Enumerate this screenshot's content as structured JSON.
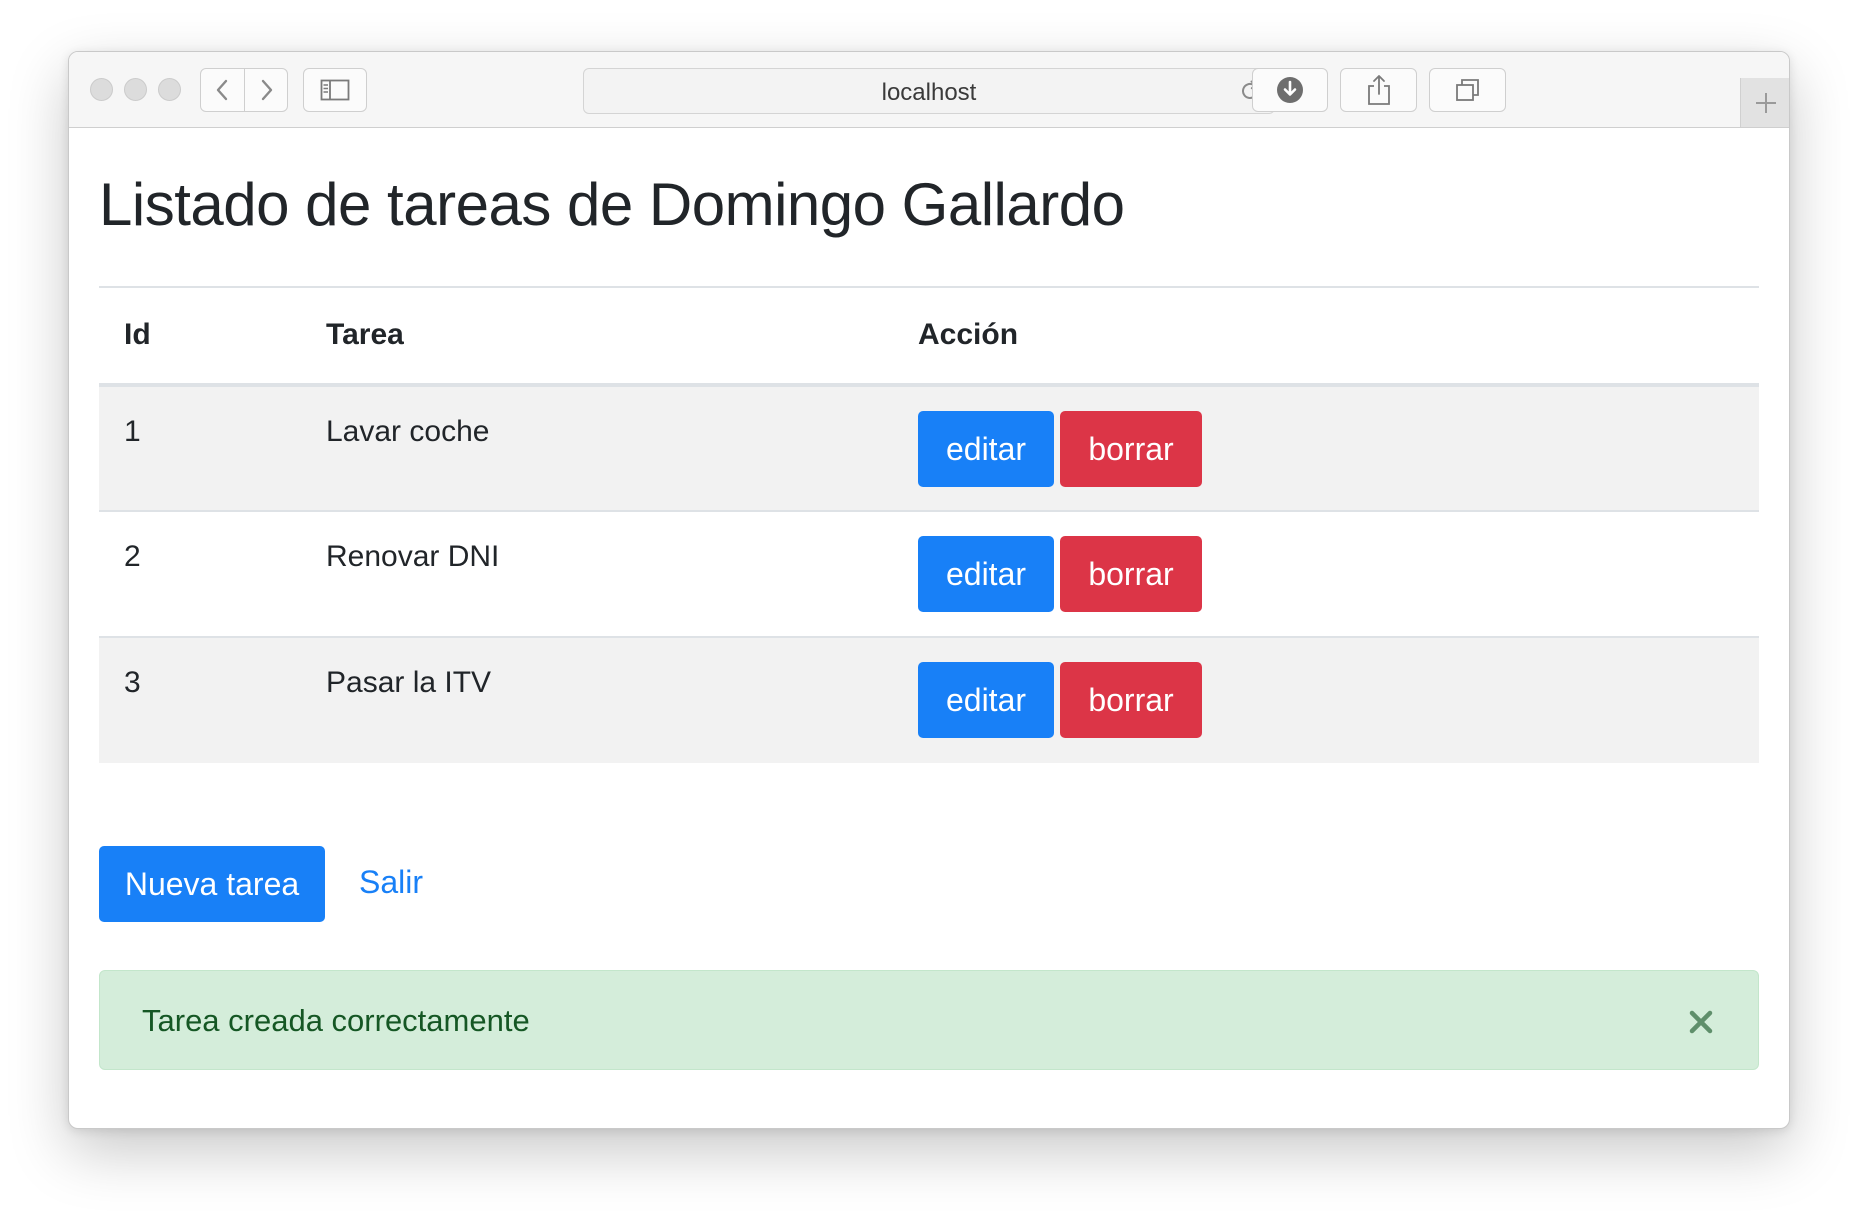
{
  "browser": {
    "url": "localhost"
  },
  "page": {
    "title": "Listado de tareas de Domingo Gallardo"
  },
  "table": {
    "headers": {
      "id": "Id",
      "task": "Tarea",
      "action": "Acción"
    },
    "rows": [
      {
        "id": "1",
        "task": "Lavar coche",
        "edit_label": "editar",
        "delete_label": "borrar"
      },
      {
        "id": "2",
        "task": "Renovar DNI",
        "edit_label": "editar",
        "delete_label": "borrar"
      },
      {
        "id": "3",
        "task": "Pasar la ITV",
        "edit_label": "editar",
        "delete_label": "borrar"
      }
    ]
  },
  "actions": {
    "new_task_label": "Nueva tarea",
    "exit_label": "Salir"
  },
  "alert": {
    "message": "Tarea creada correctamente",
    "type": "success"
  },
  "colors": {
    "primary": "#1880f7",
    "danger": "#dc3547",
    "success_bg": "#d4edda",
    "success_text": "#155724"
  },
  "icons": {
    "back": "chevron-left-icon",
    "forward": "chevron-right-icon",
    "sidebar": "sidebar-icon",
    "reload": "reload-icon",
    "download": "download-icon",
    "share": "share-icon",
    "tabs": "tabs-icon",
    "new_tab": "plus-icon",
    "close": "close-icon"
  }
}
